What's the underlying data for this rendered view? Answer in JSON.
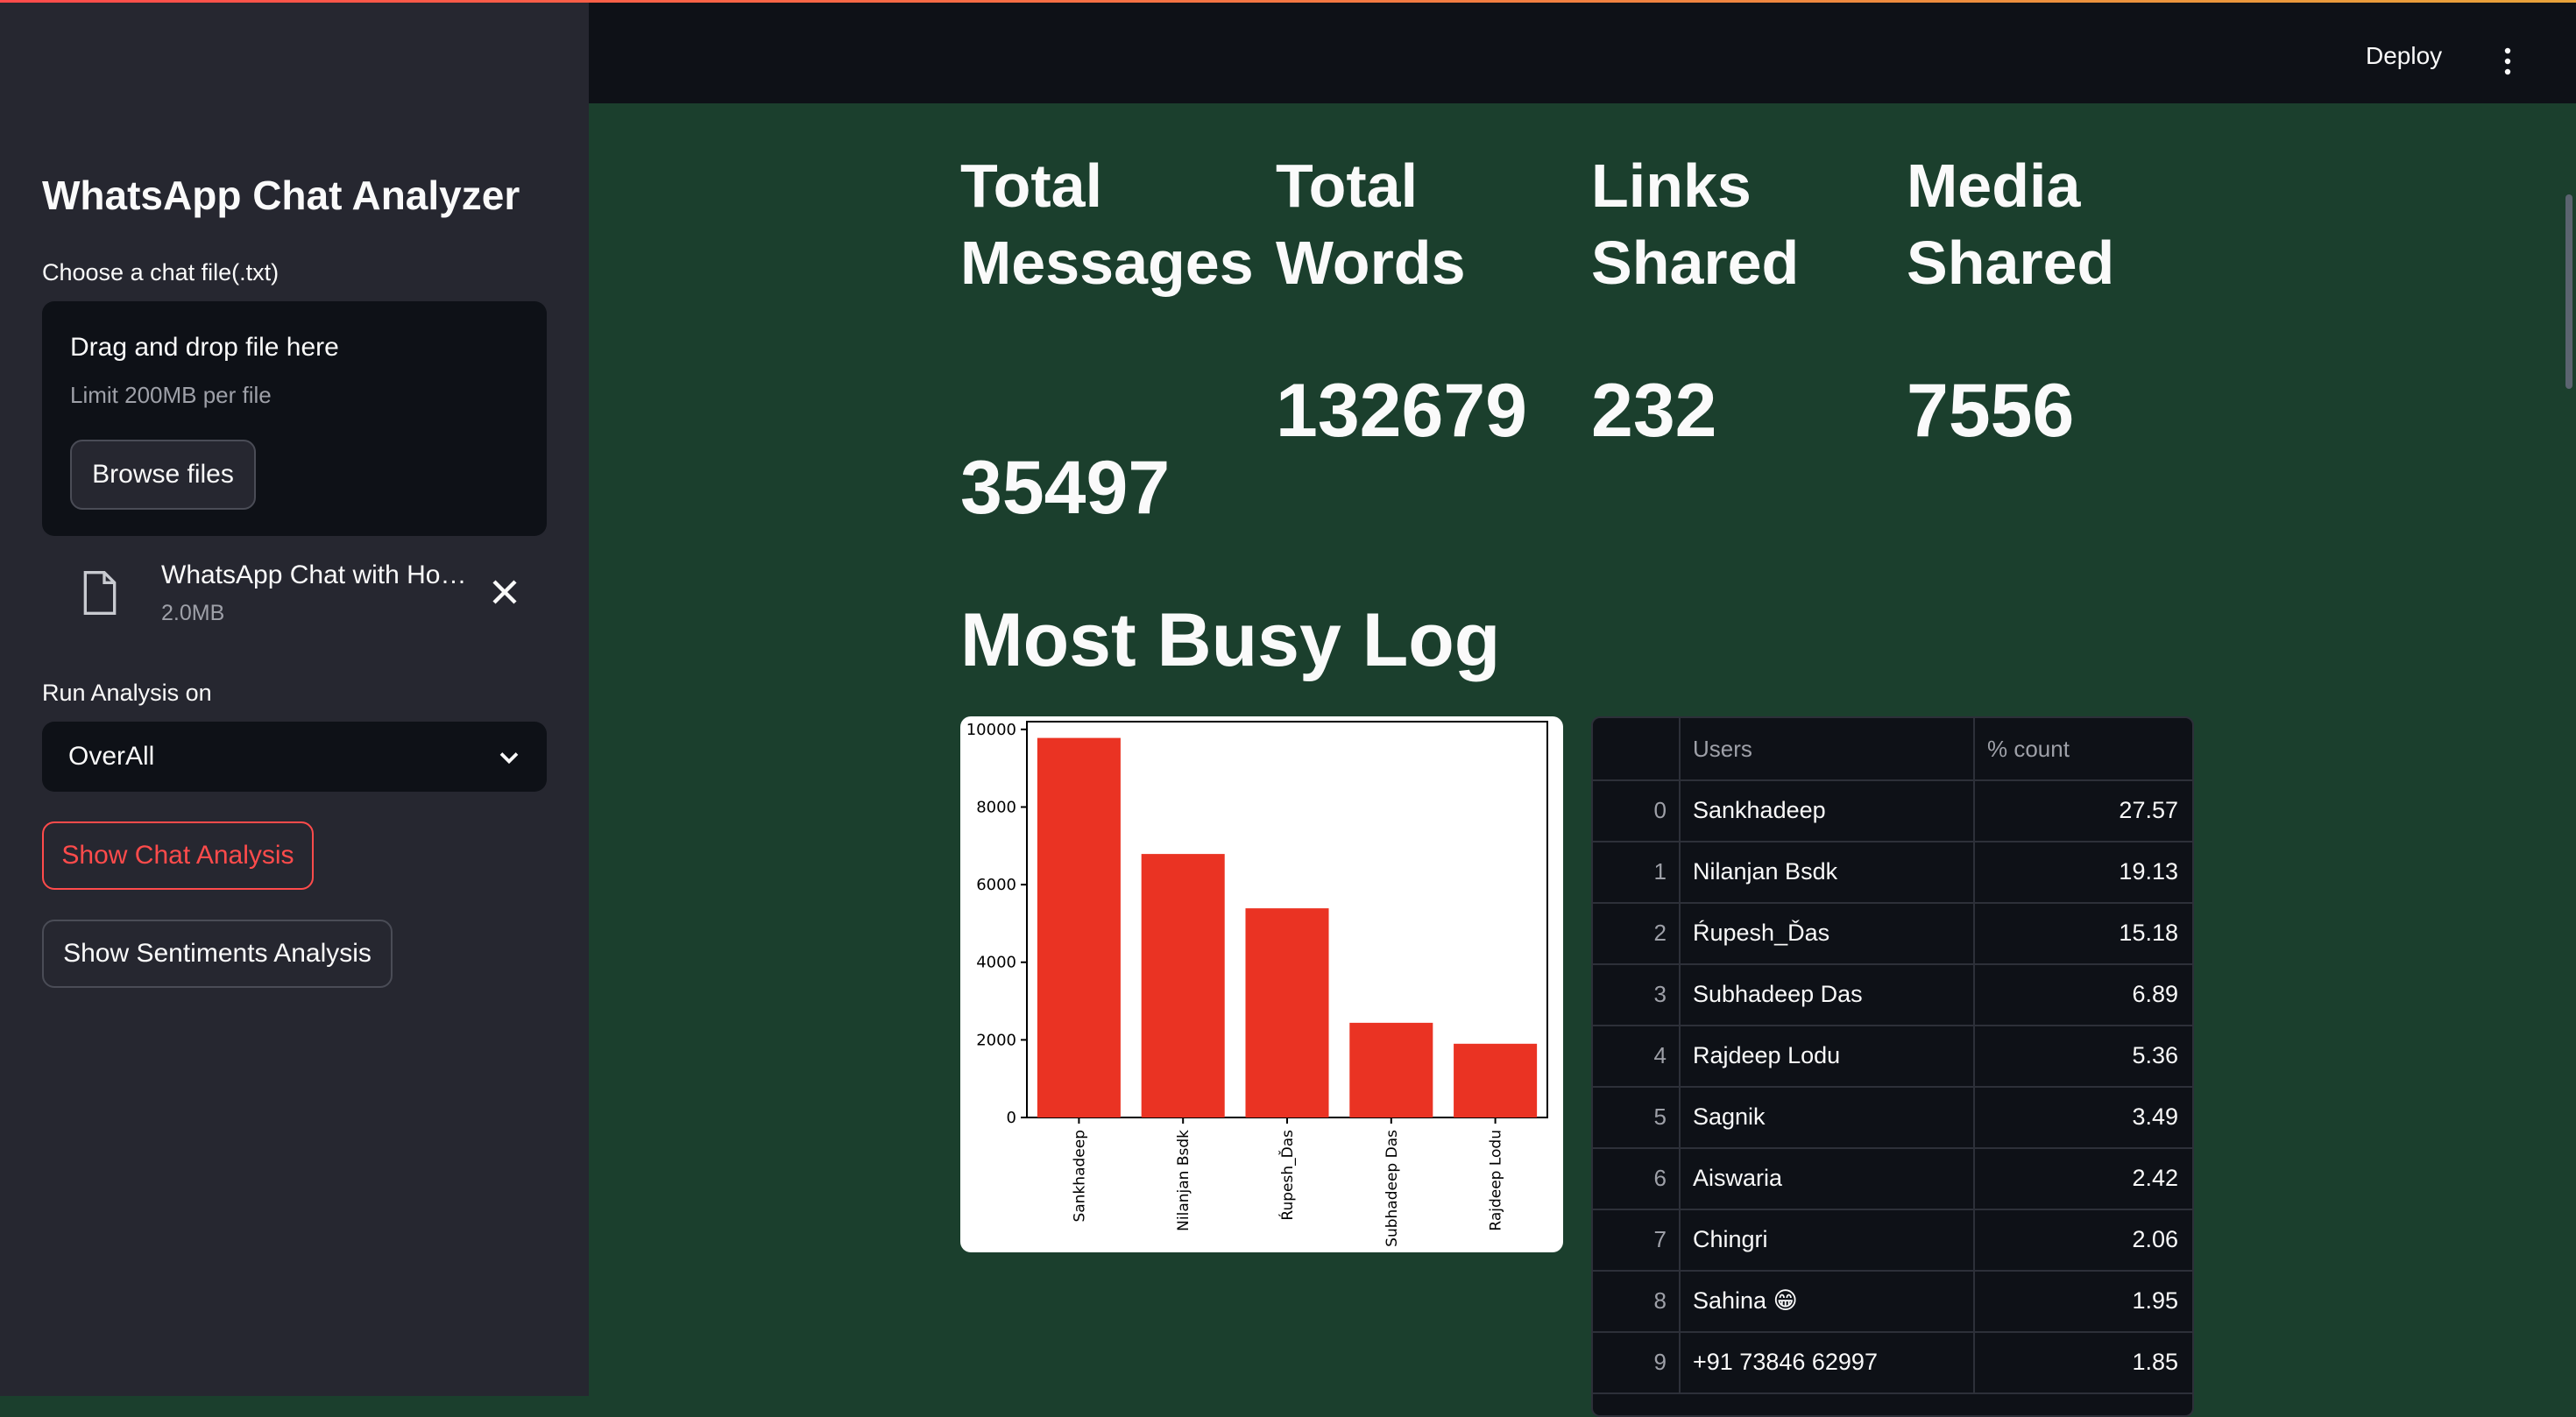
{
  "sidebar": {
    "title": "WhatsApp Chat Analyzer",
    "file_label": "Choose a chat file(.txt)",
    "dropzone": {
      "title": "Drag and drop file here",
      "limit": "Limit 200MB per file",
      "browse": "Browse files"
    },
    "file": {
      "name": "WhatsApp Chat with Ho…",
      "size": "2.0MB",
      "icon": "file-icon"
    },
    "select_label": "Run Analysis on",
    "select_value": "OverAll",
    "show_chat": "Show Chat Analysis",
    "show_sentiments": "Show Sentiments Analysis"
  },
  "header": {
    "deploy": "Deploy"
  },
  "metrics": [
    {
      "label1": "Total",
      "label2": "Messages",
      "value": "35497"
    },
    {
      "label1": "Total",
      "label2": "Words",
      "value": "132679"
    },
    {
      "label1": "Links",
      "label2": "Shared",
      "value": "232"
    },
    {
      "label1": "Media",
      "label2": "Shared",
      "value": "7556"
    }
  ],
  "section_title": "Most Busy Log",
  "colors": {
    "bar": "#ea3323",
    "accent": "#ff4b4b",
    "background": "#1b3f2d",
    "sidebar": "#262730"
  },
  "chart_data": {
    "type": "bar",
    "categories": [
      "Sankhadeep",
      "Nilanjan Bsdk",
      "Ŕupesh_Ďas",
      "Subhadeep Das",
      "Rajdeep Lodu"
    ],
    "values": [
      9780,
      6790,
      5390,
      2440,
      1900
    ],
    "yticks": [
      0,
      2000,
      4000,
      6000,
      8000,
      10000
    ],
    "ylim": [
      0,
      10200
    ]
  },
  "table": {
    "columns": [
      "Users",
      "% count"
    ],
    "rows": [
      {
        "idx": "0",
        "user": "Sankhadeep",
        "count": "27.57"
      },
      {
        "idx": "1",
        "user": "Nilanjan Bsdk",
        "count": "19.13"
      },
      {
        "idx": "2",
        "user": "Ŕupesh_Ďas",
        "count": "15.18"
      },
      {
        "idx": "3",
        "user": "Subhadeep Das",
        "count": "6.89"
      },
      {
        "idx": "4",
        "user": "Rajdeep Lodu",
        "count": "5.36"
      },
      {
        "idx": "5",
        "user": "Sagnik",
        "count": "3.49"
      },
      {
        "idx": "6",
        "user": "Aiswaria",
        "count": "2.42"
      },
      {
        "idx": "7",
        "user": "Chingri",
        "count": "2.06"
      },
      {
        "idx": "8",
        "user": "Sahina 😁",
        "count": "1.95"
      },
      {
        "idx": "9",
        "user": "+91 73846 62997",
        "count": "1.85"
      }
    ]
  }
}
